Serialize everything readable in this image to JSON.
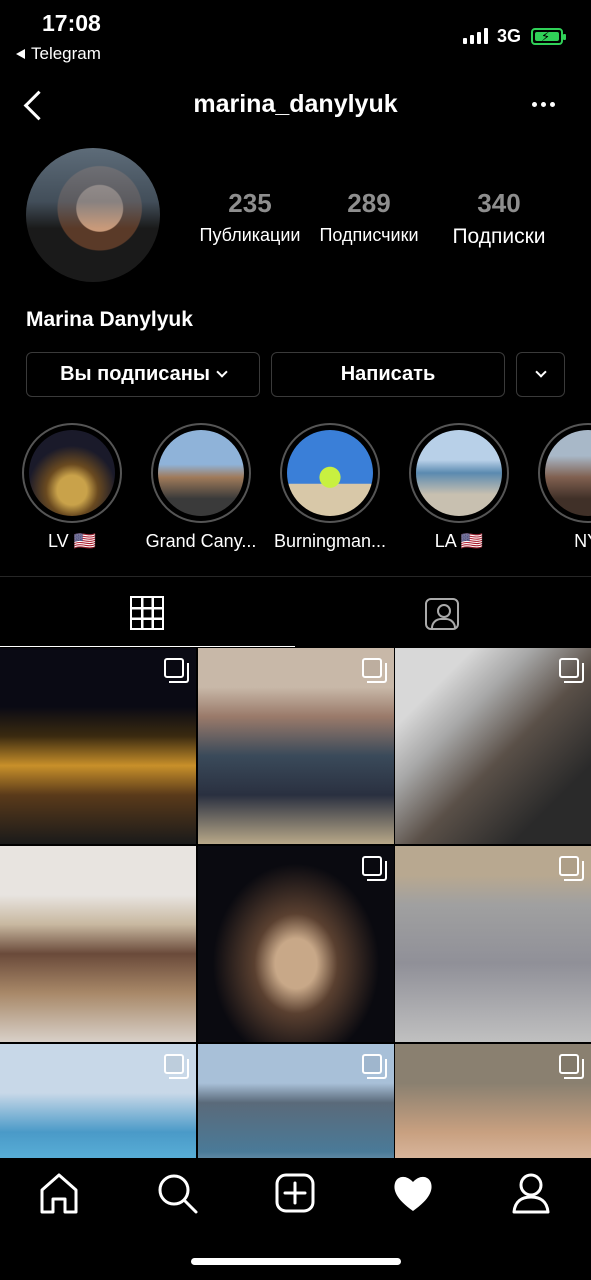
{
  "status_bar": {
    "time": "17:08",
    "back_app": "Telegram",
    "network": "3G"
  },
  "header": {
    "username": "marina_danylyuk"
  },
  "profile": {
    "full_name": "Marina Danylyuk",
    "stats": [
      {
        "value": "235",
        "label": "Публикации"
      },
      {
        "value": "289",
        "label": "Подписчики"
      },
      {
        "value": "340",
        "label": "Подписки"
      }
    ]
  },
  "actions": {
    "following_label": "Вы подписаны",
    "message_label": "Написать"
  },
  "highlights": [
    {
      "label": "LV 🇺🇸"
    },
    {
      "label": "Grand Cany..."
    },
    {
      "label": "Burningman..."
    },
    {
      "label": "LA 🇺🇸"
    },
    {
      "label": "NY, "
    }
  ],
  "tabs": [
    {
      "name": "grid-icon"
    },
    {
      "name": "tagged-icon"
    }
  ],
  "colors": {
    "background": "#000000",
    "stat_number": "#8e8e8e",
    "battery": "#30d158",
    "border": "#3a3a3a"
  },
  "bottom_nav": [
    {
      "name": "home-icon"
    },
    {
      "name": "search-icon"
    },
    {
      "name": "add-post-icon"
    },
    {
      "name": "heart-icon"
    },
    {
      "name": "profile-icon"
    }
  ]
}
